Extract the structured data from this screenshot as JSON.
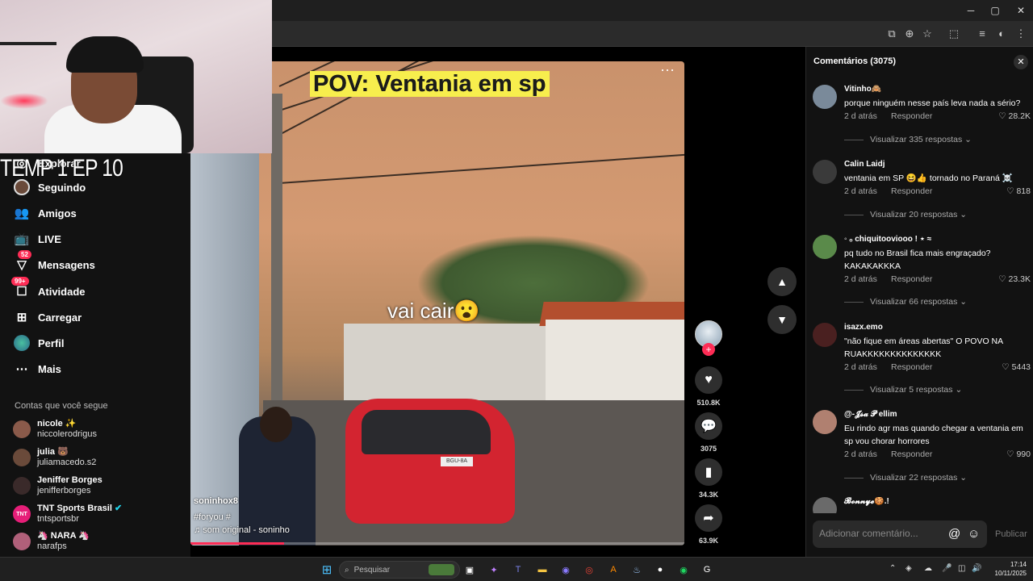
{
  "overlay_text": "TEMP 1 EP 10",
  "sidebar": {
    "items": [
      {
        "label": "Explorar",
        "icon": "compass-icon"
      },
      {
        "label": "Seguindo",
        "icon": "following-avatar-icon"
      },
      {
        "label": "Amigos",
        "icon": "friends-icon"
      },
      {
        "label": "LIVE",
        "icon": "live-icon"
      },
      {
        "label": "Mensagens",
        "icon": "messages-icon",
        "badge": "52"
      },
      {
        "label": "Atividade",
        "icon": "activity-icon",
        "badge": "99+"
      },
      {
        "label": "Carregar",
        "icon": "upload-icon"
      },
      {
        "label": "Perfil",
        "icon": "profile-icon"
      },
      {
        "label": "Mais",
        "icon": "more-icon"
      }
    ],
    "following_title": "Contas que você segue",
    "following": [
      {
        "name": "nicole ✨",
        "handle": "niccolerodrigus",
        "color": "#8a5a4a"
      },
      {
        "name": "julia 🐻",
        "handle": "juliamacedo.s2",
        "color": "#6a4a3a"
      },
      {
        "name": "Jeniffer Borges",
        "handle": "jenifferborges",
        "color": "#3a2a2a"
      },
      {
        "name": "TNT Sports Brasil",
        "handle": "tntsportsbr",
        "color": "#e61e78",
        "avatar_text": "TNT"
      },
      {
        "name": "🦄 NARA 🦄",
        "handle": "narafps",
        "color": "#b0607a"
      }
    ]
  },
  "video": {
    "title": "POV: Ventania em sp",
    "caption": "vai cair😮",
    "username": "soninhox8",
    "tags": "#foryou  #",
    "sound": "♫ som original - soninho",
    "plate": "BGU-8A",
    "progress": 0.19
  },
  "actions": {
    "likes": "510.8K",
    "comments": "3075",
    "saves": "34.3K",
    "shares": "63.9K"
  },
  "comments_panel": {
    "title": "Comentários (3075)",
    "reply_label": "Responder",
    "input_placeholder": "Adicionar comentário...",
    "publish_label": "Publicar",
    "comments": [
      {
        "user": "Vitinho🙈",
        "text": "porque ninguém nesse país leva nada a sério?",
        "time": "2 d atrás",
        "likes": "28.2K",
        "view_replies": "Visualizar 335 respostas",
        "avatar_color": "#7a8a9a"
      },
      {
        "user": "Calin Laidj",
        "text": "ventania em SP 😆👍 tornado no Paraná ☠️",
        "time": "2 d atrás",
        "likes": "818",
        "view_replies": "Visualizar 20 respostas",
        "avatar_color": "#3a3a3a"
      },
      {
        "user": "◦ ₒ chiquitooviooo ! ⋆ ≈",
        "text": "pq tudo no Brasil fica mais engraçado? KAKAKAKKKA",
        "time": "2 d atrás",
        "likes": "23.3K",
        "view_replies": "Visualizar 66 respostas",
        "avatar_color": "#5a8a4a"
      },
      {
        "user": "isazx.emo",
        "text": "\"não fique em áreas abertas\" O POVO NA RUAKKKKKKKKKKKKKK",
        "time": "2 d atrás",
        "likes": "5443",
        "view_replies": "Visualizar 5 respostas",
        "avatar_color": "#4a2020"
      },
      {
        "user": "@-𝓙𝓼𝓪 𝓟 ellim",
        "text": "Eu rindo agr mas quando chegar a ventania em sp vou chorar horrores",
        "time": "2 d atrás",
        "likes": "990",
        "view_replies": "Visualizar 22 respostas",
        "avatar_color": "#b08070"
      },
      {
        "user": "𝓑𝓸𝓷𝓷𝔂𝓮🍪.!",
        "avatar_color": "#6a6a6a"
      }
    ]
  },
  "taskbar": {
    "search_placeholder": "Pesquisar",
    "time": "17:14",
    "date": "10/11/2025"
  }
}
